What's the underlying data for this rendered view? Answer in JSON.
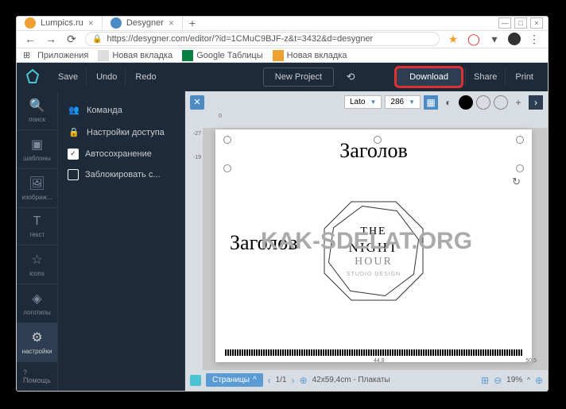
{
  "browser": {
    "tabs": [
      {
        "label": "Lumpics.ru",
        "color": "#f0a030"
      },
      {
        "label": "Desygner",
        "color": "#4a8bc4",
        "active": true
      }
    ],
    "url": "https://desygner.com/editor/?id=1CMuC9BJF-z&t=3432&d=desygner",
    "bookmarks": {
      "apps": "Приложения",
      "items": [
        "Новая вкладка",
        "Google Таблицы",
        "Новая вкладка"
      ]
    }
  },
  "topbar": {
    "save": "Save",
    "undo": "Undo",
    "redo": "Redo",
    "newproject": "New Project",
    "download": "Download",
    "share": "Share",
    "print": "Print"
  },
  "sidebar": {
    "items": [
      {
        "label": "поиск"
      },
      {
        "label": "шаблоны"
      },
      {
        "label": "изображ..."
      },
      {
        "label": "текст"
      },
      {
        "label": "icons"
      },
      {
        "label": "логотипы"
      },
      {
        "label": "настройки",
        "active": true
      }
    ],
    "help": "? Помощь"
  },
  "panel": {
    "items": [
      {
        "icon": "team",
        "label": "Команда"
      },
      {
        "icon": "lock",
        "label": "Настройки доступа"
      },
      {
        "icon": "check",
        "label": "Автосохранение",
        "checked": true
      },
      {
        "icon": "box",
        "label": "Заблокировать с..."
      }
    ]
  },
  "toolbar": {
    "font": "Lato",
    "size": "286"
  },
  "canvas": {
    "text1": "Заголов",
    "text2": "Заголов",
    "center1": "THE",
    "center2": "NIGHT",
    "center3": "HOUR",
    "sub": "STUDIO DESIGN",
    "ruler": {
      "v1": "-27",
      "v2": "-19",
      "h1": "0",
      "h2": "44,8",
      "h3": "50,5"
    }
  },
  "bottombar": {
    "pages": "Страницы",
    "pg": "1/1",
    "dims": "42x59,4cm - Плакаты",
    "zoom": "19%"
  },
  "watermark": "KAK-SDELAT.ORG"
}
